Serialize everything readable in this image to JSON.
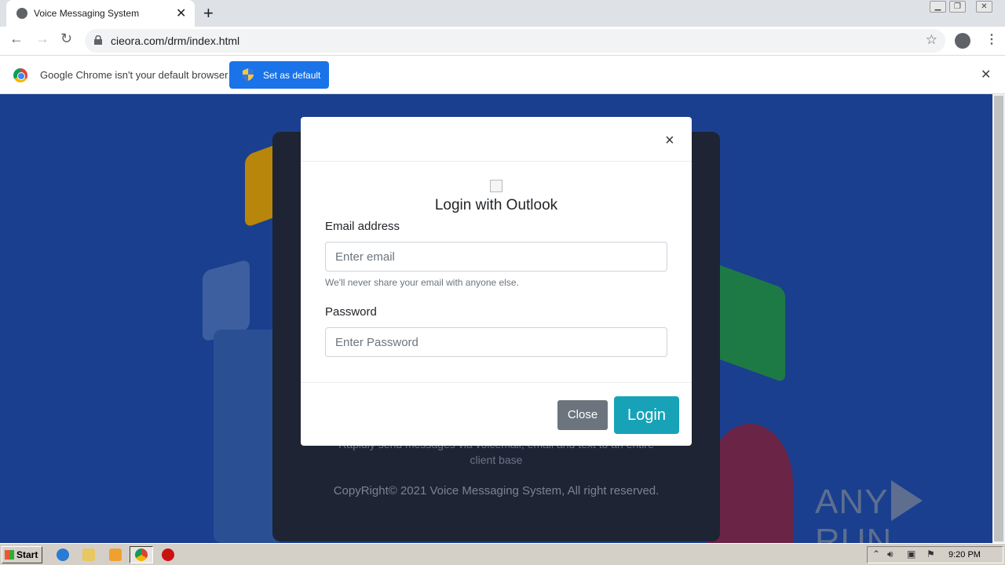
{
  "browser": {
    "tab_title": "Voice Messaging System",
    "tab_close": "✕",
    "new_tab": "+",
    "url": "cieora.com/drm/index.html"
  },
  "infobar": {
    "message": "Google Chrome isn't your default browser",
    "set_default_label": "Set as default",
    "close": "✕"
  },
  "page": {
    "bg_text_line1": "Rapidly send messages via voicemail, email and text to an entire",
    "bg_text_line2": "client base",
    "copyright": "CopyRight© 2021 Voice Messaging System, All right reserved.",
    "watermark_left": "ANY",
    "watermark_right": "RUN"
  },
  "modal": {
    "close_x": "×",
    "title": "Login with Outlook",
    "email_label": "Email address",
    "email_placeholder": "Enter email",
    "email_help": "We'll never share your email with anyone else.",
    "password_label": "Password",
    "password_placeholder": "Enter Password",
    "close_button": "Close",
    "login_button": "Login"
  },
  "taskbar": {
    "start_label": "Start",
    "clock": "9:20 PM"
  },
  "colors": {
    "page_bg": "#1a3f8f",
    "login_button": "#17a2b8",
    "close_button": "#6c757d",
    "set_default": "#1a73e8"
  }
}
